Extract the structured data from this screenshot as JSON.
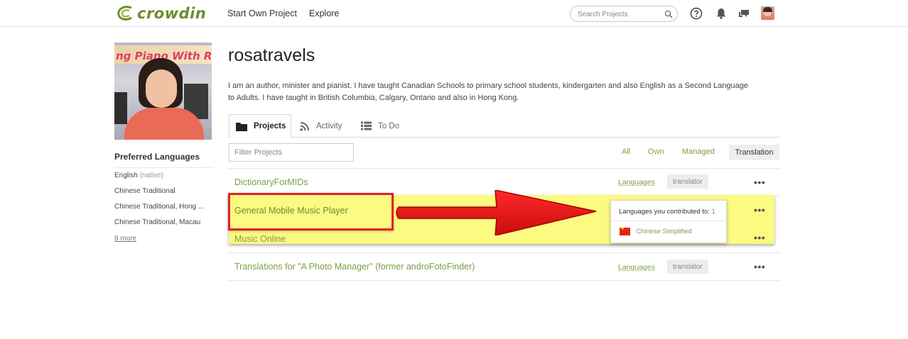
{
  "header": {
    "logo_text": "crowdin",
    "nav": [
      "Start Own Project",
      "Explore"
    ],
    "search_placeholder": "Search Projects",
    "icons": [
      "help-icon",
      "bell-icon",
      "chat-icon"
    ]
  },
  "profile": {
    "photo_banner_text": "ng Piano With R",
    "username": "rosatravels",
    "bio": "I am an author, minister and pianist. I have taught Canadian Schools to primary school students, kindergarten and also English as a Second Language to Adults. I have taught in British Columbia, Calgary, Ontario and also in Hong Kong."
  },
  "preferred_languages": {
    "title": "Preferred Languages",
    "items": [
      {
        "name": "English",
        "note": "(native)"
      },
      {
        "name": "Chinese Traditional",
        "note": ""
      },
      {
        "name": "Chinese Traditional, Hong ...",
        "note": ""
      },
      {
        "name": "Chinese Traditional, Macau",
        "note": ""
      }
    ],
    "more_link": "8 more"
  },
  "tabs": [
    {
      "label": "Projects",
      "icon": "folder-icon",
      "active": true
    },
    {
      "label": "Activity",
      "icon": "rss-icon",
      "active": false
    },
    {
      "label": "To Do",
      "icon": "list-icon",
      "active": false
    }
  ],
  "filter": {
    "placeholder": "Filter Projects",
    "options": [
      "All",
      "Own",
      "Managed",
      "Translation"
    ],
    "selected": "Translation"
  },
  "projects": [
    {
      "name": "DictionaryForMIDs",
      "languages_link": "Languages",
      "role": "translator",
      "menu": "•••"
    },
    {
      "name": "General Mobile Music Player",
      "languages_link": "",
      "role": "",
      "menu": "•••"
    },
    {
      "name": "Music Online",
      "languages_link": "",
      "role": "",
      "menu": "•••"
    },
    {
      "name": "Translations for \"A Photo Manager\" (former androFotoFinder)",
      "languages_link": "Languages",
      "role": "translator",
      "menu": "•••"
    }
  ],
  "popover": {
    "title": "Languages you contributed to:",
    "count": "1",
    "language": "Chinese Simplified",
    "flag": "china-flag-icon"
  },
  "colors": {
    "brand_green": "#7b9e4a",
    "highlight_yellow": "#fbfa81",
    "annotation_red": "#e0222a"
  }
}
